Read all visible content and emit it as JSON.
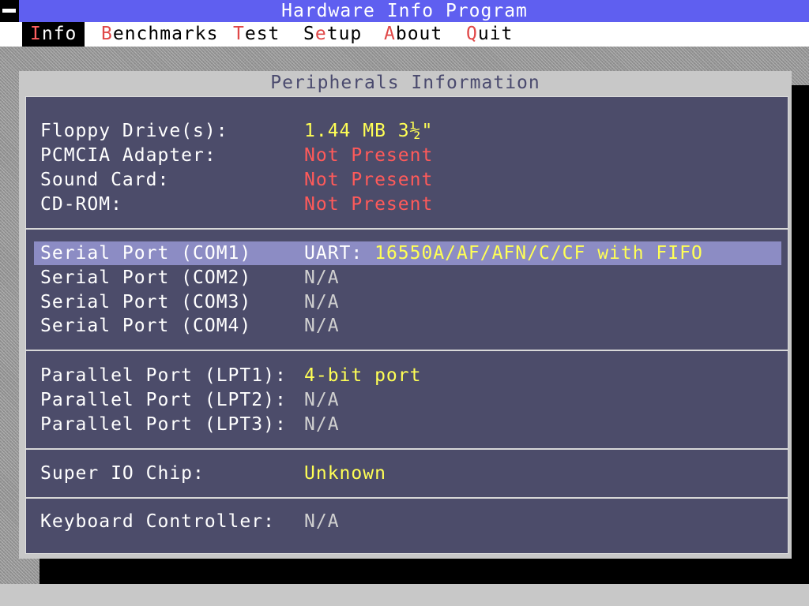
{
  "window": {
    "title": "Hardware Info Program"
  },
  "menu": [
    {
      "hotkey": "I",
      "rest": "nfo"
    },
    {
      "hotkey": "B",
      "rest": "enchmarks"
    },
    {
      "hotkey": "T",
      "rest": "est"
    },
    {
      "pre": "S",
      "hotkey": "e",
      "rest": "tup"
    },
    {
      "hotkey": "A",
      "rest": "bout"
    },
    {
      "hotkey": "Q",
      "rest": "uit"
    }
  ],
  "dialog": {
    "title": "Peripherals Information",
    "floppy": {
      "label": "Floppy Drive(s):",
      "value": "1.44 MB 3½\""
    },
    "pcmcia": {
      "label": "PCMCIA Adapter:",
      "value": "Not Present"
    },
    "sound": {
      "label": "Sound Card:",
      "value": "Not Present"
    },
    "cdrom": {
      "label": "CD-ROM:",
      "value": "Not Present"
    },
    "com1": {
      "label": "Serial Port (COM1)",
      "value_prefix": "UART: ",
      "value": "16550A/AF/AFN/C/CF with FIFO"
    },
    "com2": {
      "label": "Serial Port (COM2)",
      "value": "N/A"
    },
    "com3": {
      "label": "Serial Port (COM3)",
      "value": "N/A"
    },
    "com4": {
      "label": "Serial Port (COM4)",
      "value": "N/A"
    },
    "lpt1": {
      "label": "Parallel Port (LPT1):",
      "value": "4-bit port"
    },
    "lpt2": {
      "label": "Parallel Port (LPT2):",
      "value": "N/A"
    },
    "lpt3": {
      "label": "Parallel Port (LPT3):",
      "value": "N/A"
    },
    "superio": {
      "label": "Super IO Chip:",
      "value": "Unknown"
    },
    "kbc": {
      "label": "Keyboard Controller:",
      "value": "N/A"
    }
  },
  "colors": {
    "titlebar": "#5f5ff0",
    "panel": "#4c4c6a",
    "highlight": "#8c8cc4",
    "value_yellow": "#ffff55",
    "value_red": "#ff5a5a",
    "hotkey_red": "#e04848"
  }
}
